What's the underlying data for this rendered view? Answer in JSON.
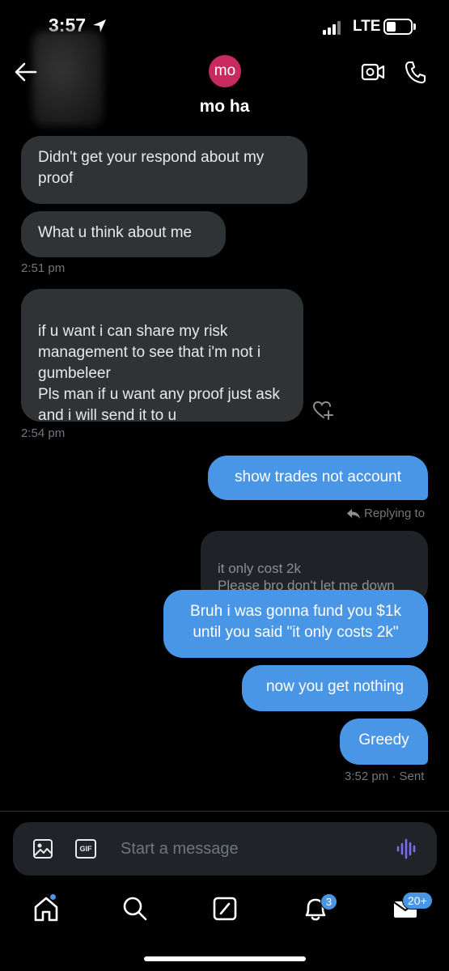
{
  "status_bar": {
    "time": "3:57",
    "network": "LTE"
  },
  "header": {
    "avatar_initials": "mo",
    "avatar_color": "#c72a5e",
    "contact_name": "mo ha"
  },
  "messages": {
    "in_1": "Didn't get your respond about my proof",
    "in_2": "What u think about me",
    "ts_1": "2:51 pm",
    "in_3": "if u want i can share my risk management to see that i'm not i gumbeleer\nPls man if u want any proof just ask and i will send it to u",
    "ts_2": "2:54 pm",
    "out_1": "show trades not account",
    "replying_label": "Replying to",
    "quoted_text": "it only cost 2k\nPlease bro don't let me down",
    "out_2": "Bruh i was gonna fund you $1k until you said \"it only costs 2k\"",
    "out_3": "now you get nothing",
    "out_4": "Greedy",
    "ts_3": "3:52 pm",
    "ts_3_status": "· Sent"
  },
  "composer": {
    "placeholder": "Start a message",
    "gif_label": "GIF"
  },
  "nav": {
    "notifications_count": "3",
    "messages_count": "20+"
  },
  "colors": {
    "accent": "#4a96e6",
    "incoming_bubble": "#2f3336",
    "background": "#000000"
  }
}
